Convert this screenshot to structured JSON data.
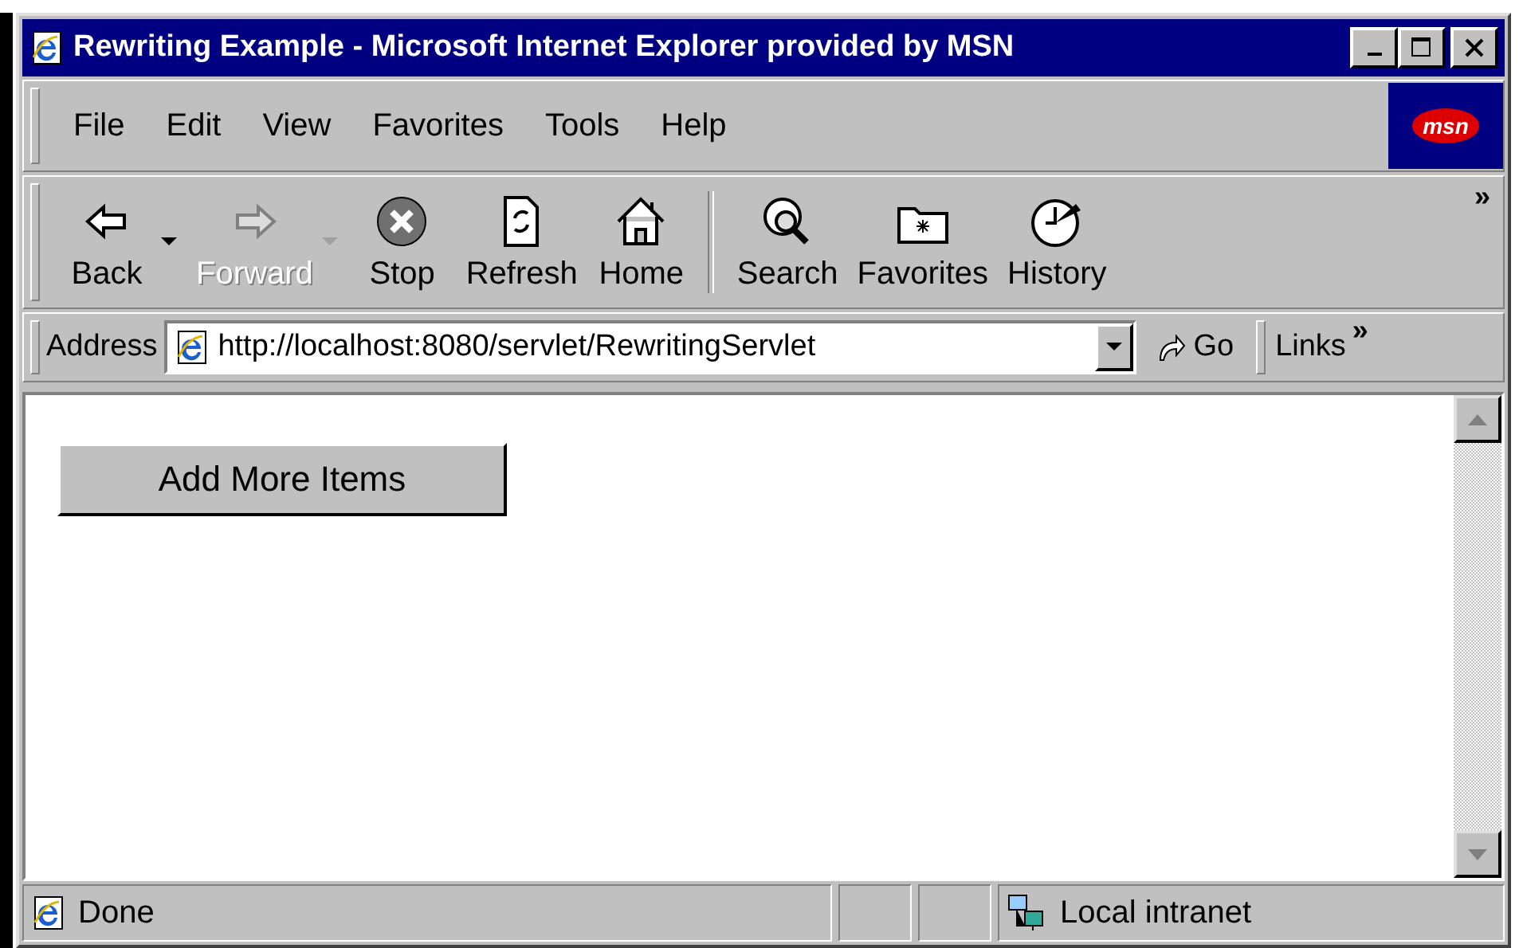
{
  "window": {
    "title": "Rewriting Example - Microsoft Internet Explorer provided by MSN"
  },
  "menu": [
    {
      "label": "File"
    },
    {
      "label": "Edit"
    },
    {
      "label": "View"
    },
    {
      "label": "Favorites"
    },
    {
      "label": "Tools"
    },
    {
      "label": "Help"
    }
  ],
  "brand": {
    "label": "msn"
  },
  "toolbar": [
    {
      "kind": "back",
      "label": "Back",
      "disabled": false,
      "dropdown": true
    },
    {
      "kind": "forward",
      "label": "Forward",
      "disabled": true,
      "dropdown": true
    },
    {
      "kind": "stop",
      "label": "Stop",
      "disabled": false,
      "dropdown": false
    },
    {
      "kind": "refresh",
      "label": "Refresh",
      "disabled": false,
      "dropdown": false
    },
    {
      "kind": "home",
      "label": "Home",
      "disabled": false,
      "dropdown": false
    },
    {
      "kind": "separator"
    },
    {
      "kind": "search",
      "label": "Search",
      "disabled": false,
      "dropdown": false
    },
    {
      "kind": "favorites",
      "label": "Favorites",
      "disabled": false,
      "dropdown": false
    },
    {
      "kind": "history",
      "label": "History",
      "disabled": false,
      "dropdown": false
    }
  ],
  "toolbar_more": "»",
  "address_bar": {
    "label": "Address",
    "value": "http://localhost:8080/servlet/RewritingServlet",
    "go": "Go",
    "links": "Links",
    "links_more": "»"
  },
  "page": {
    "buttons": [
      {
        "label": "Add More Items"
      }
    ]
  },
  "status_bar": {
    "text": "Done",
    "zone": "Local intranet"
  }
}
